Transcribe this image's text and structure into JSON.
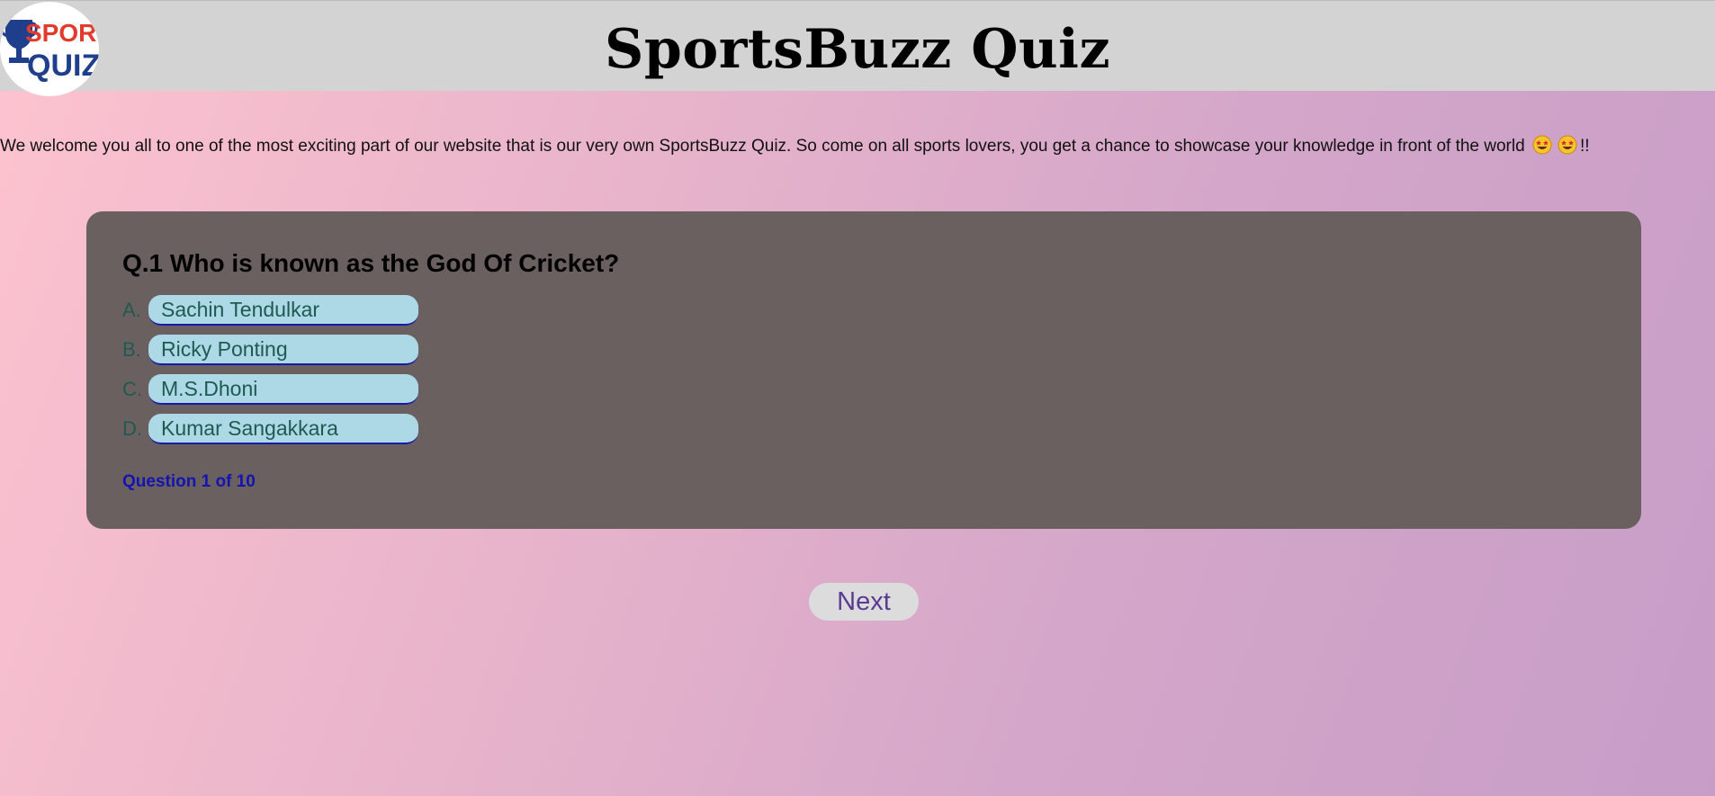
{
  "header": {
    "logo_text_top": "SPORTS",
    "logo_text_bottom": "QUIZ",
    "title": "SportsBuzz Quiz"
  },
  "welcome": {
    "text": "We welcome you all to one of the most exciting part of our website that is our very own SportsBuzz Quiz. So come on all sports lovers, you get a chance to showcase your knowledge in front of the world",
    "suffix": "!!",
    "emoji": "star-struck-emoji"
  },
  "quiz": {
    "question": "Q.1 Who is known as the God Of Cricket?",
    "options": [
      {
        "letter": "A.",
        "label": "Sachin Tendulkar"
      },
      {
        "letter": "B.",
        "label": "Ricky Ponting"
      },
      {
        "letter": "C.",
        "label": "M.S.Dhoni"
      },
      {
        "letter": "D.",
        "label": "Kumar Sangakkara"
      }
    ],
    "progress": "Question 1 of 10"
  },
  "next_label": "Next",
  "colors": {
    "card": "#6b6060",
    "option": "#add8e6",
    "progress": "#1414b0",
    "next_text": "#5b3a94"
  }
}
